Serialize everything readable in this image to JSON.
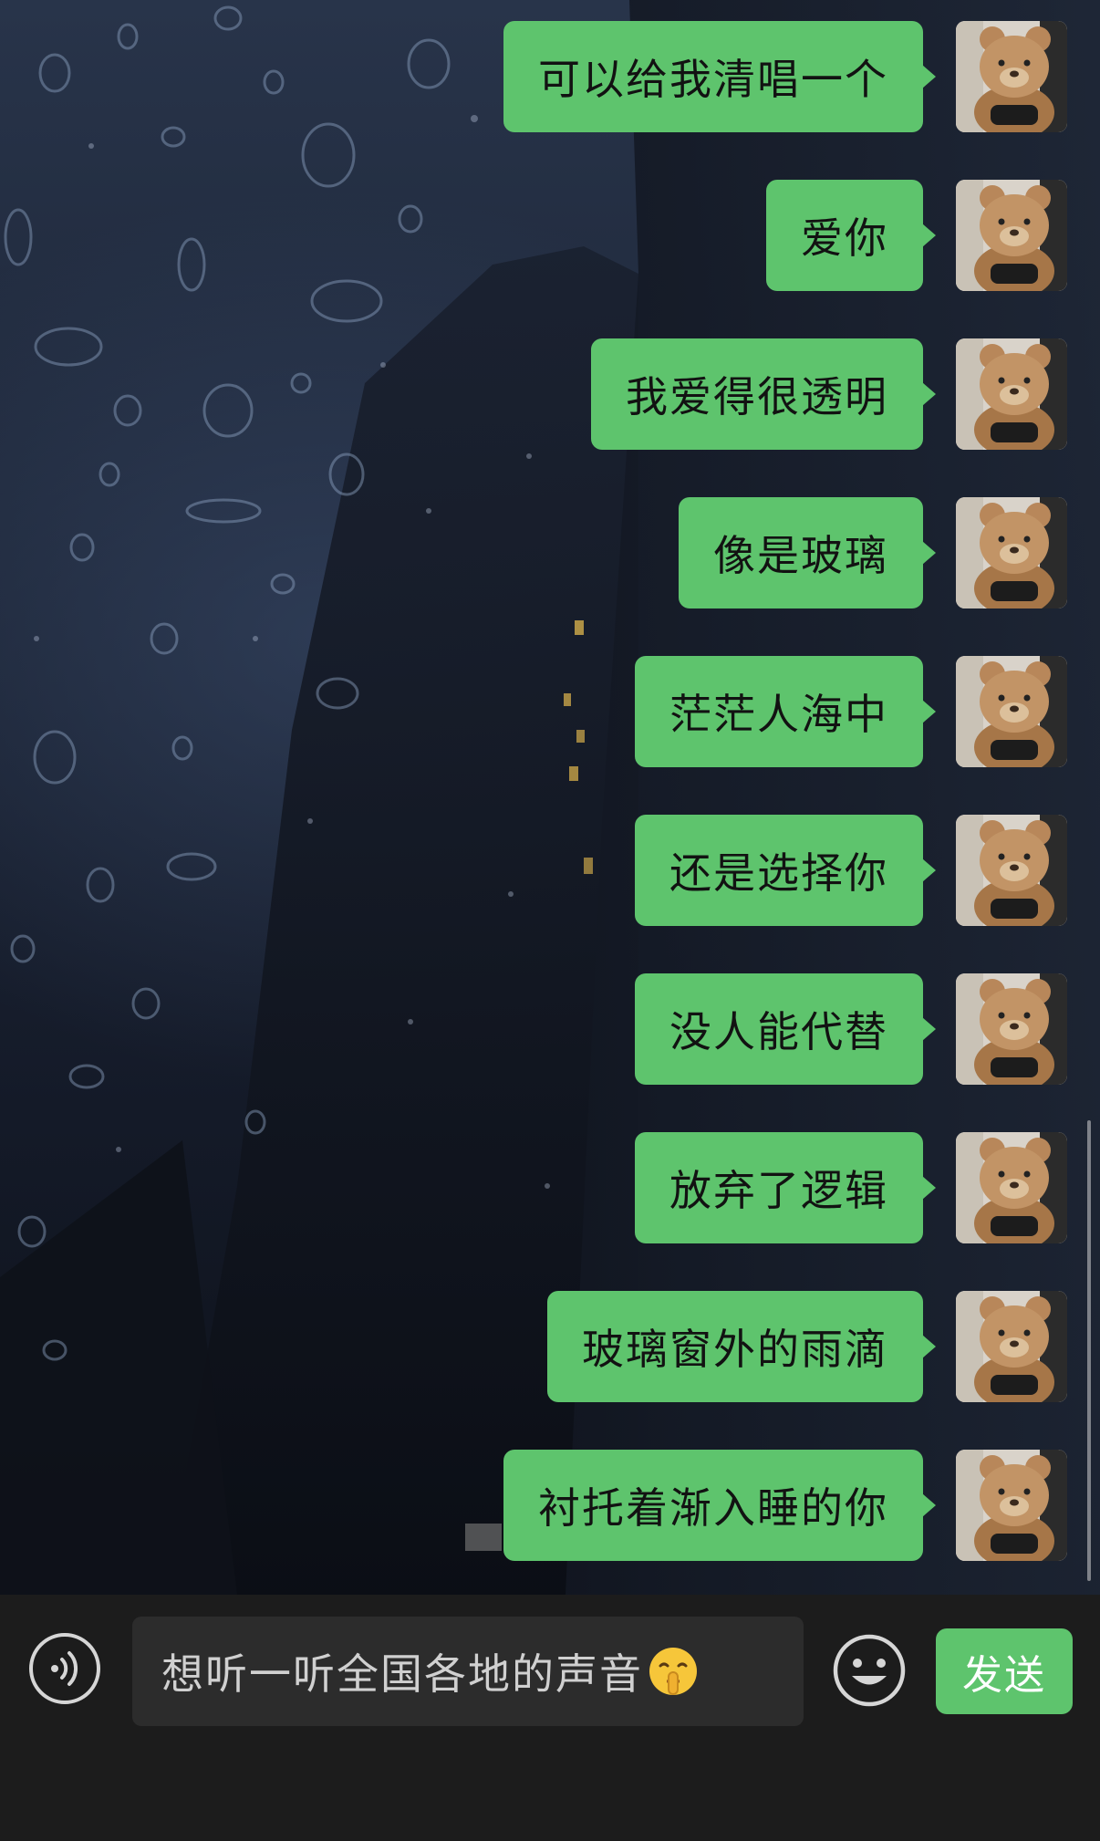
{
  "messages": [
    {
      "text": "可以给我清唱一个"
    },
    {
      "text": "爱你"
    },
    {
      "text": "我爱得很透明"
    },
    {
      "text": "像是玻璃"
    },
    {
      "text": "茫茫人海中"
    },
    {
      "text": "还是选择你"
    },
    {
      "text": "没人能代替"
    },
    {
      "text": "放弃了逻辑"
    },
    {
      "text": "玻璃窗外的雨滴"
    },
    {
      "text": "衬托着渐入睡的你"
    }
  ],
  "avatar": {
    "icon": "teddy-bear-avatar"
  },
  "input": {
    "value": "想听一听全国各地的声音",
    "emoji": "shushing-face-emoji"
  },
  "toolbar": {
    "voice_icon": "voice-icon",
    "emoji_icon": "smiley-icon",
    "send_label": "发送"
  },
  "colors": {
    "bubble": "#5ec46d",
    "input_bar": "#1c1c1c",
    "input_field": "#2c2c2c",
    "send_button": "#5ec46d"
  }
}
